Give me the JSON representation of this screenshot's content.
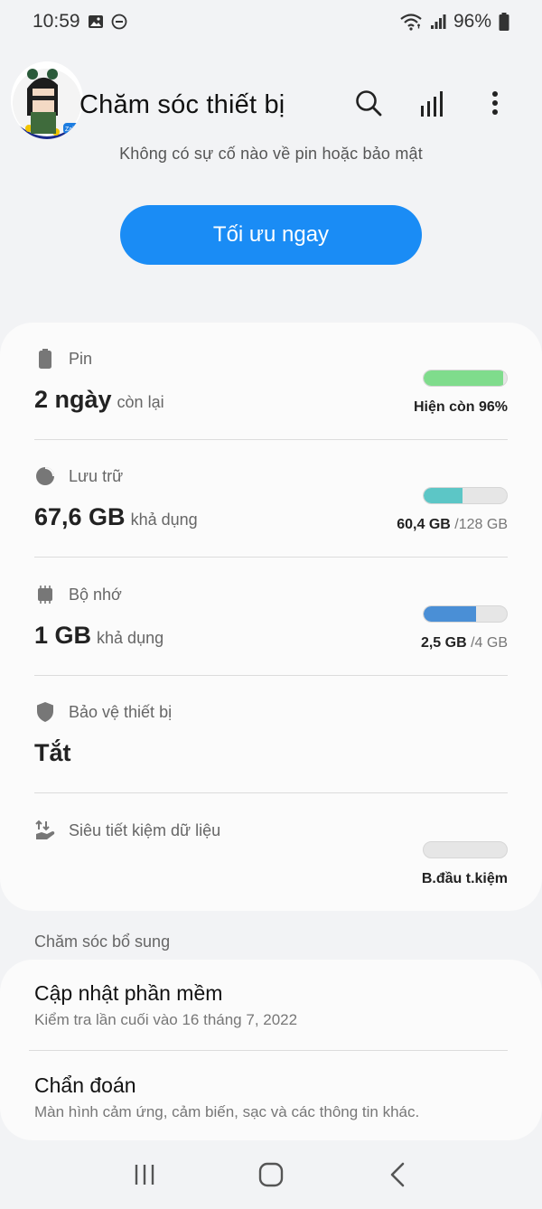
{
  "status_bar": {
    "time": "10:59",
    "battery_percent": "96%",
    "icons": [
      "gallery-icon",
      "dnd-icon",
      "wifi-icon",
      "signal-icon",
      "battery-icon"
    ]
  },
  "header": {
    "title": "Chăm sóc thiết bị",
    "avatar_text": "Zalo",
    "actions": [
      "search-icon",
      "chart-icon",
      "more-icon"
    ]
  },
  "summary": {
    "text": "Không có sự cố nào về pin hoặc bảo mật",
    "button_label": "Tối ưu ngay"
  },
  "rows": {
    "battery": {
      "label": "Pin",
      "value": "2 ngày",
      "unit": "còn lại",
      "bar_fraction": 0.96,
      "bar_color": "#7fdc8c",
      "caption_main": "Hiện còn 96%",
      "caption_muted": ""
    },
    "storage": {
      "label": "Lưu trữ",
      "value": "67,6 GB",
      "unit": "khả dụng",
      "bar_fraction": 0.47,
      "bar_color": "#5cc6c6",
      "caption_main": "60,4 GB",
      "caption_muted": "/128 GB"
    },
    "memory": {
      "label": "Bộ nhớ",
      "value": "1 GB",
      "unit": "khả dụng",
      "bar_fraction": 0.625,
      "bar_color": "#4a8fd6",
      "caption_main": "2,5 GB",
      "caption_muted": "/4 GB"
    },
    "protection": {
      "label": "Bảo vệ thiết bị",
      "value": "Tắt"
    },
    "data_saver": {
      "label": "Siêu tiết kiệm dữ liệu",
      "bar_fraction": 0,
      "caption_main": "B.đầu t.kiệm"
    }
  },
  "extra": {
    "header": "Chăm sóc bổ sung",
    "items": [
      {
        "title": "Cập nhật phần mềm",
        "subtitle": "Kiểm tra lần cuối vào 16 tháng 7, 2022"
      },
      {
        "title": "Chẩn đoán",
        "subtitle": "Màn hình cảm ứng, cảm biến, sạc và các thông tin khác."
      }
    ]
  },
  "nav": [
    "recent-apps-icon",
    "home-icon",
    "back-icon"
  ]
}
